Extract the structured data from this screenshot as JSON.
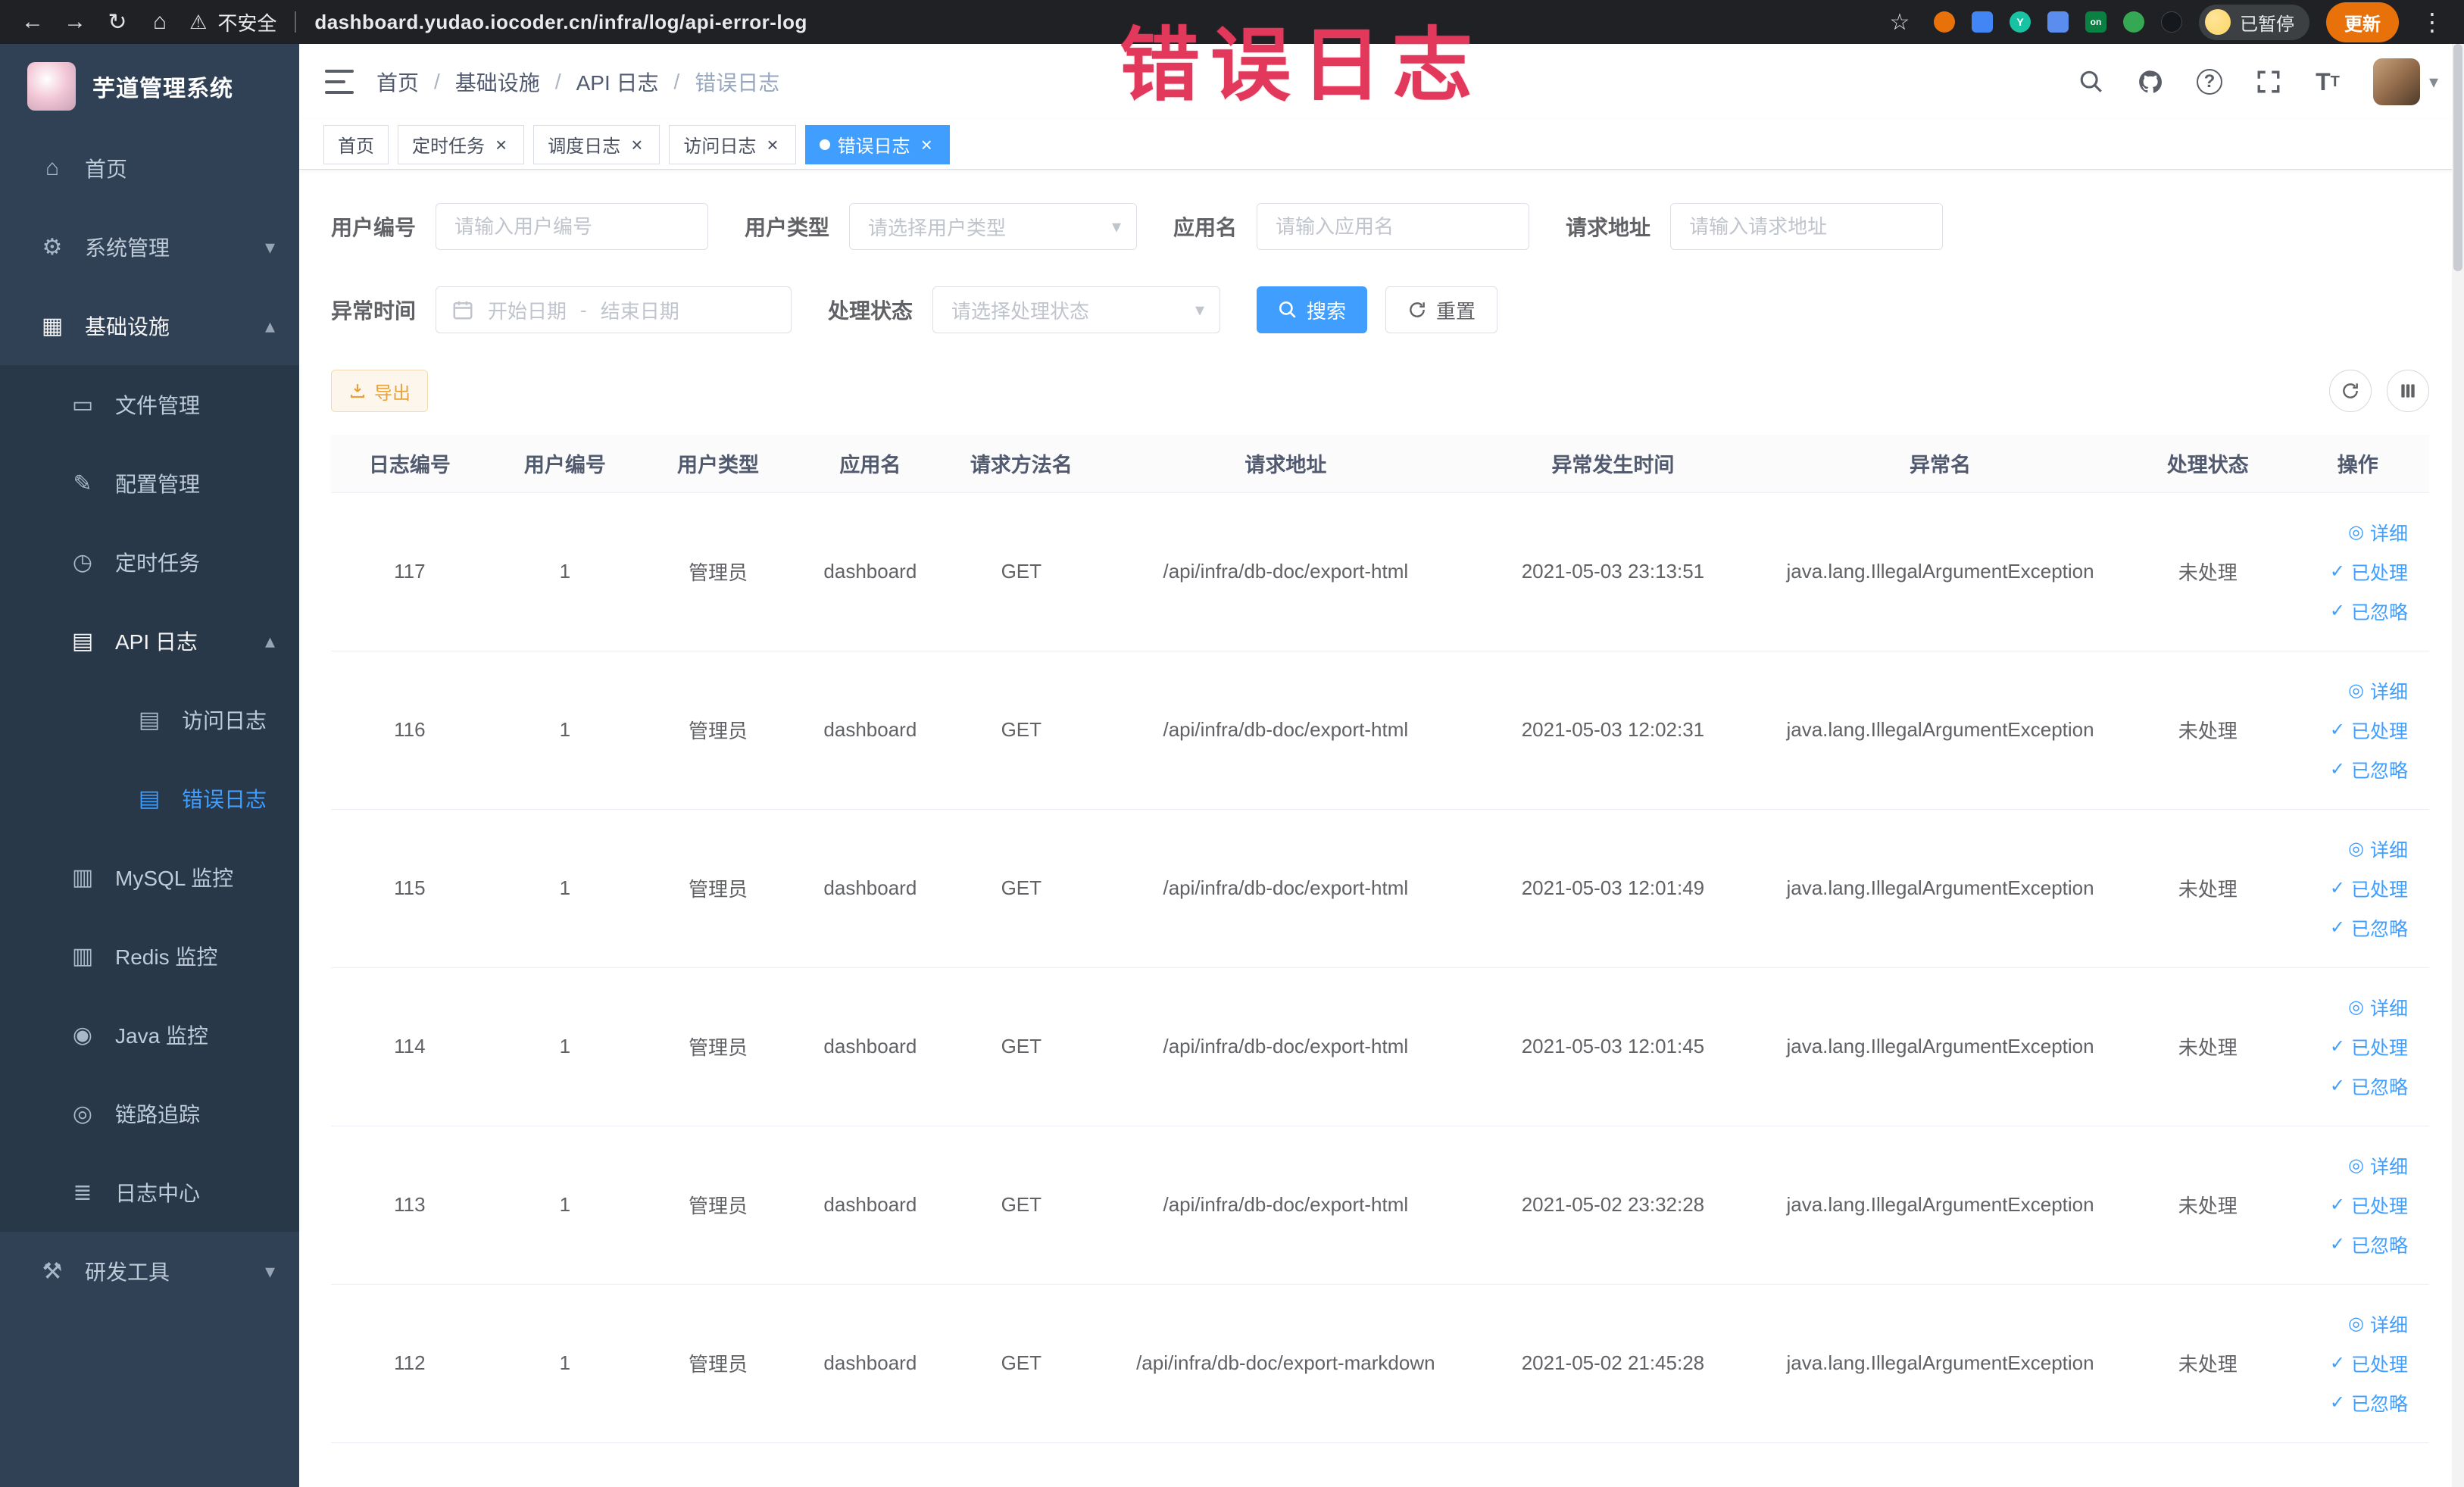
{
  "theme": {
    "accent": "#409eff",
    "annotation": "#e2385c",
    "sidebar-bg": "#304156",
    "submenu-bg": "#283848",
    "chrome-bg": "#202124",
    "warning": "#e6a23c"
  },
  "icons": {
    "back": "←",
    "forward": "→",
    "reload": "↻",
    "home": "⌂",
    "warning": "⚠",
    "star": "☆",
    "kebab": "⋮",
    "caret-down": "▾",
    "caret-up": "▴",
    "close": "×",
    "eye": "◎",
    "check": "✓"
  },
  "browser": {
    "security_label": "不安全",
    "url": "dashboard.yudao.iocoder.cn/infra/log/api-error-log",
    "profile_label": "已暂停",
    "update_label": "更新"
  },
  "annotation": {
    "text": "错误日志"
  },
  "sidebar": {
    "logo_title": "芋道管理系统",
    "items": [
      {
        "label": "首页",
        "icon": "⌂"
      },
      {
        "label": "系统管理",
        "icon": "⚙"
      },
      {
        "label": "基础设施",
        "icon": "▦"
      },
      {
        "label": "文件管理",
        "icon": "▭"
      },
      {
        "label": "配置管理",
        "icon": "✎"
      },
      {
        "label": "定时任务",
        "icon": "◷"
      },
      {
        "label": "API 日志",
        "icon": "▤"
      },
      {
        "label": "访问日志",
        "icon": "▤"
      },
      {
        "label": "错误日志",
        "icon": "▤"
      },
      {
        "label": "MySQL 监控",
        "icon": "▥"
      },
      {
        "label": "Redis 监控",
        "icon": "▥"
      },
      {
        "label": "Java 监控",
        "icon": "◉"
      },
      {
        "label": "链路追踪",
        "icon": "◎"
      },
      {
        "label": "日志中心",
        "icon": "≣"
      },
      {
        "label": "研发工具",
        "icon": "⚒"
      }
    ]
  },
  "breadcrumb": {
    "separator": "/",
    "items": [
      "首页",
      "基础设施",
      "API 日志",
      "错误日志"
    ]
  },
  "tabs": {
    "items": [
      "首页",
      "定时任务",
      "调度日志",
      "访问日志",
      "错误日志"
    ]
  },
  "filters": {
    "user_id": {
      "label": "用户编号",
      "placeholder": "请输入用户编号"
    },
    "user_type": {
      "label": "用户类型",
      "placeholder": "请选择用户类型"
    },
    "app_name": {
      "label": "应用名",
      "placeholder": "请输入应用名"
    },
    "request_url": {
      "label": "请求地址",
      "placeholder": "请输入请求地址"
    },
    "exception_time": {
      "label": "异常时间",
      "start_placeholder": "开始日期",
      "separator": "-",
      "end_placeholder": "结束日期"
    },
    "process_status": {
      "label": "处理状态",
      "placeholder": "请选择处理状态"
    },
    "search_button": "搜索",
    "reset_button": "重置"
  },
  "toolbar": {
    "export_button": "导出"
  },
  "table": {
    "headers": [
      "日志编号",
      "用户编号",
      "用户类型",
      "应用名",
      "请求方法名",
      "请求地址",
      "异常发生时间",
      "异常名",
      "处理状态",
      "操作"
    ],
    "actions": [
      "详细",
      "已处理",
      "已忽略"
    ],
    "rows": [
      {
        "id": "117",
        "user_id": "1",
        "user_type": "管理员",
        "app": "dashboard",
        "method": "GET",
        "url": "/api/infra/db-doc/export-html",
        "time": "2021-05-03 23:13:51",
        "exception": "java.lang.IllegalArgumentException",
        "status": "未处理"
      },
      {
        "id": "116",
        "user_id": "1",
        "user_type": "管理员",
        "app": "dashboard",
        "method": "GET",
        "url": "/api/infra/db-doc/export-html",
        "time": "2021-05-03 12:02:31",
        "exception": "java.lang.IllegalArgumentException",
        "status": "未处理"
      },
      {
        "id": "115",
        "user_id": "1",
        "user_type": "管理员",
        "app": "dashboard",
        "method": "GET",
        "url": "/api/infra/db-doc/export-html",
        "time": "2021-05-03 12:01:49",
        "exception": "java.lang.IllegalArgumentException",
        "status": "未处理"
      },
      {
        "id": "114",
        "user_id": "1",
        "user_type": "管理员",
        "app": "dashboard",
        "method": "GET",
        "url": "/api/infra/db-doc/export-html",
        "time": "2021-05-03 12:01:45",
        "exception": "java.lang.IllegalArgumentException",
        "status": "未处理"
      },
      {
        "id": "113",
        "user_id": "1",
        "user_type": "管理员",
        "app": "dashboard",
        "method": "GET",
        "url": "/api/infra/db-doc/export-html",
        "time": "2021-05-02 23:32:28",
        "exception": "java.lang.IllegalArgumentException",
        "status": "未处理"
      },
      {
        "id": "112",
        "user_id": "1",
        "user_type": "管理员",
        "app": "dashboard",
        "method": "GET",
        "url": "/api/infra/db-doc/export-markdown",
        "time": "2021-05-02 21:45:28",
        "exception": "java.lang.IllegalArgumentException",
        "status": "未处理"
      }
    ]
  }
}
